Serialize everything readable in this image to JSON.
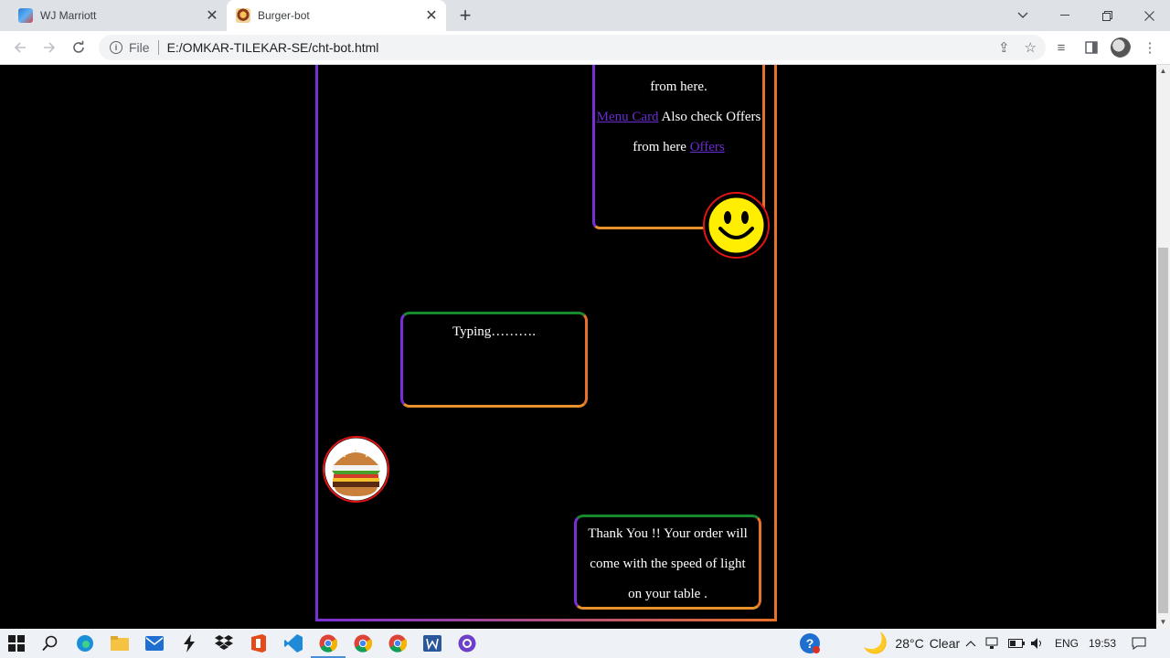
{
  "browser": {
    "tabs": [
      {
        "title": "WJ Marriott",
        "active": false
      },
      {
        "title": "Burger-bot",
        "active": true
      }
    ],
    "address": {
      "scheme": "File",
      "url": "E:/OMKAR-TILEKAR-SE/cht-bot.html"
    }
  },
  "chat": {
    "bot_message_top": {
      "line1": "from here.",
      "menu_link": "Menu Card",
      "middle": " Also check Offers",
      "line3_prefix": "from here ",
      "offers_link": "Offers"
    },
    "typing": "Typing……….",
    "confirmation": "Thank You !! Your order will come with the speed of light on your table ."
  },
  "taskbar": {
    "weather": {
      "temp": "28°C",
      "condition": "Clear"
    },
    "language": "ENG",
    "time": "19:53"
  },
  "colors": {
    "border_purple": "#7a2fd6",
    "border_orange": "#e8702a",
    "border_green": "#178a2e",
    "avatar_ring": "#e01414"
  }
}
